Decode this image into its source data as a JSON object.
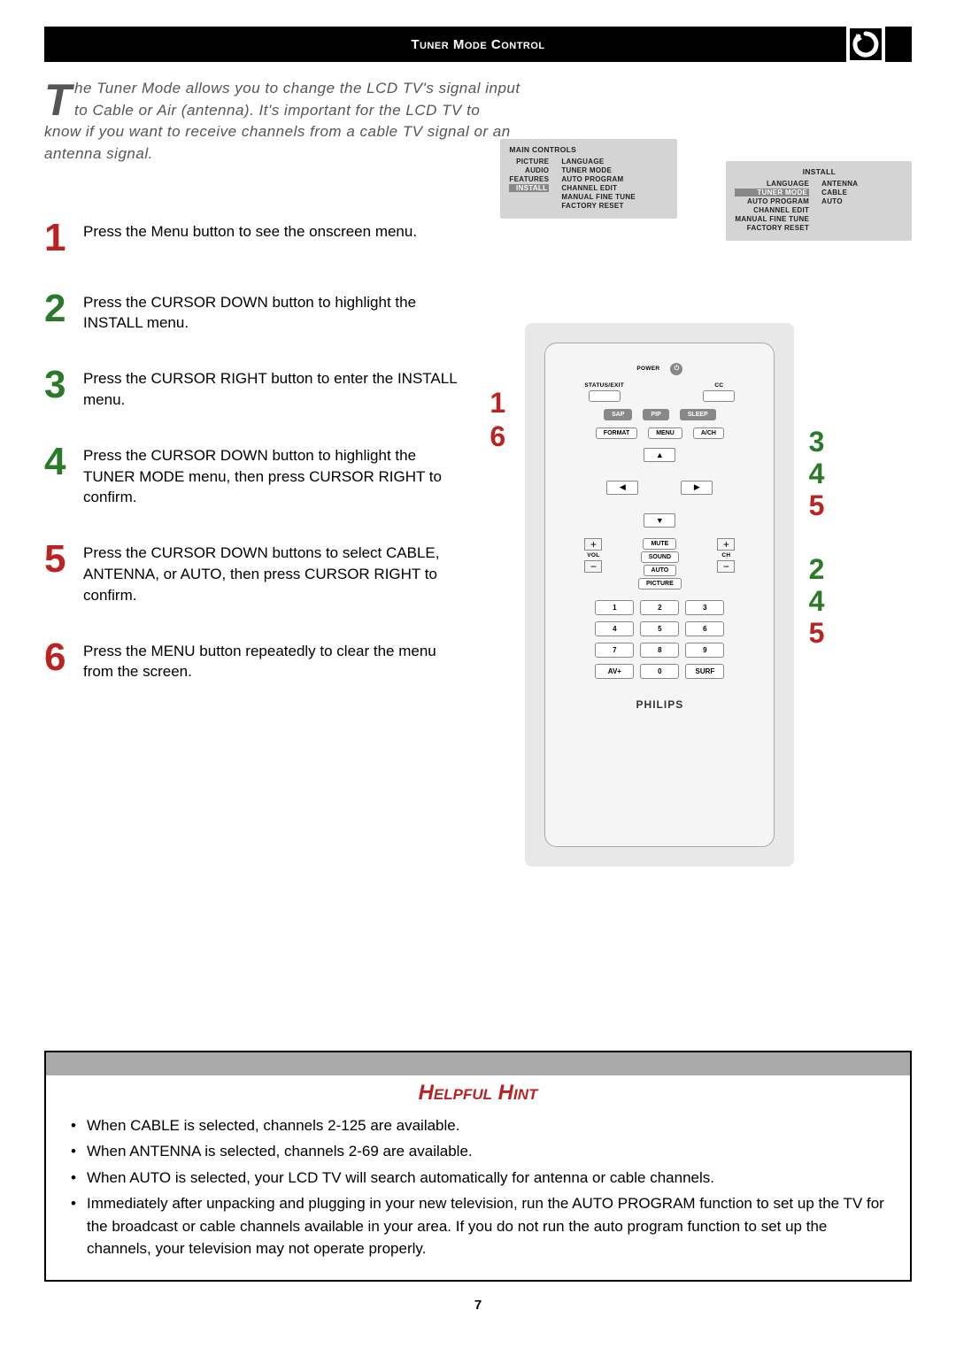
{
  "header": {
    "title": "Tuner Mode Control"
  },
  "intro": {
    "dropcap": "T",
    "text": "he Tuner Mode allows you to change the LCD TV's signal input to Cable or Air (antenna). It's important for the LCD TV to know if you want to receive channels from a cable TV signal or an antenna signal."
  },
  "steps": [
    {
      "num": "1",
      "style": "red",
      "text": "Press the Menu button to see the onscreen menu."
    },
    {
      "num": "2",
      "style": "green",
      "text": "Press the CURSOR DOWN button to highlight the INSTALL menu."
    },
    {
      "num": "3",
      "style": "green",
      "text": "Press the CURSOR RIGHT button to enter the INSTALL menu."
    },
    {
      "num": "4",
      "style": "green",
      "text": "Press the CURSOR DOWN button to highlight the TUNER MODE menu, then press CURSOR RIGHT to confirm."
    },
    {
      "num": "5",
      "style": "red",
      "text": "Press the CURSOR DOWN buttons to select CABLE, ANTENNA, or AUTO, then press CURSOR RIGHT to confirm."
    },
    {
      "num": "6",
      "style": "red",
      "text": "Press the MENU button repeatedly to clear the menu from the screen."
    }
  ],
  "menu1": {
    "title": "MAIN CONTROLS",
    "left": [
      "PICTURE",
      "AUDIO",
      "FEATURES",
      "INSTALL"
    ],
    "left_hl_index": 3,
    "right": [
      "LANGUAGE",
      "TUNER MODE",
      "AUTO PROGRAM",
      "CHANNEL EDIT",
      "MANUAL FINE TUNE",
      "FACTORY RESET"
    ]
  },
  "menu2": {
    "title": "INSTALL",
    "left": [
      "LANGUAGE",
      "TUNER MODE",
      "AUTO PROGRAM",
      "CHANNEL EDIT",
      "MANUAL FINE TUNE",
      "FACTORY RESET"
    ],
    "left_hl_index": 1,
    "right": [
      "ANTENNA",
      "CABLE",
      "AUTO"
    ]
  },
  "remote": {
    "power": "POWER",
    "status_exit": "STATUS/EXIT",
    "cc": "CC",
    "sap": "SAP",
    "pip": "PIP",
    "sleep": "SLEEP",
    "format": "FORMAT",
    "menu": "MENU",
    "ach": "A/CH",
    "mute": "MUTE",
    "sound": "SOUND",
    "auto": "AUTO",
    "picture": "PICTURE",
    "vol": "VOL",
    "ch": "CH",
    "nums": [
      "1",
      "2",
      "3",
      "4",
      "5",
      "6",
      "7",
      "8",
      "9",
      "AV+",
      "0",
      "SURF"
    ],
    "brand": "PHILIPS"
  },
  "callouts": {
    "left_top": "1",
    "left_bottom": "6",
    "r1": "3",
    "r2": "4",
    "r3": "5",
    "r4": "2",
    "r5": "4",
    "r6": "5"
  },
  "hint": {
    "title": "Helpful Hint",
    "items": [
      "When CABLE is selected, channels 2-125 are available.",
      "When ANTENNA is selected, channels 2-69 are available.",
      "When AUTO is selected, your LCD TV will search automatically for antenna or cable channels.",
      "Immediately after unpacking and plugging in your new television, run the AUTO PROGRAM function to set up the TV for the broadcast or cable channels available in your area. If you do not run the auto program function to set up the channels, your television may not operate properly."
    ]
  },
  "page_number": "7"
}
